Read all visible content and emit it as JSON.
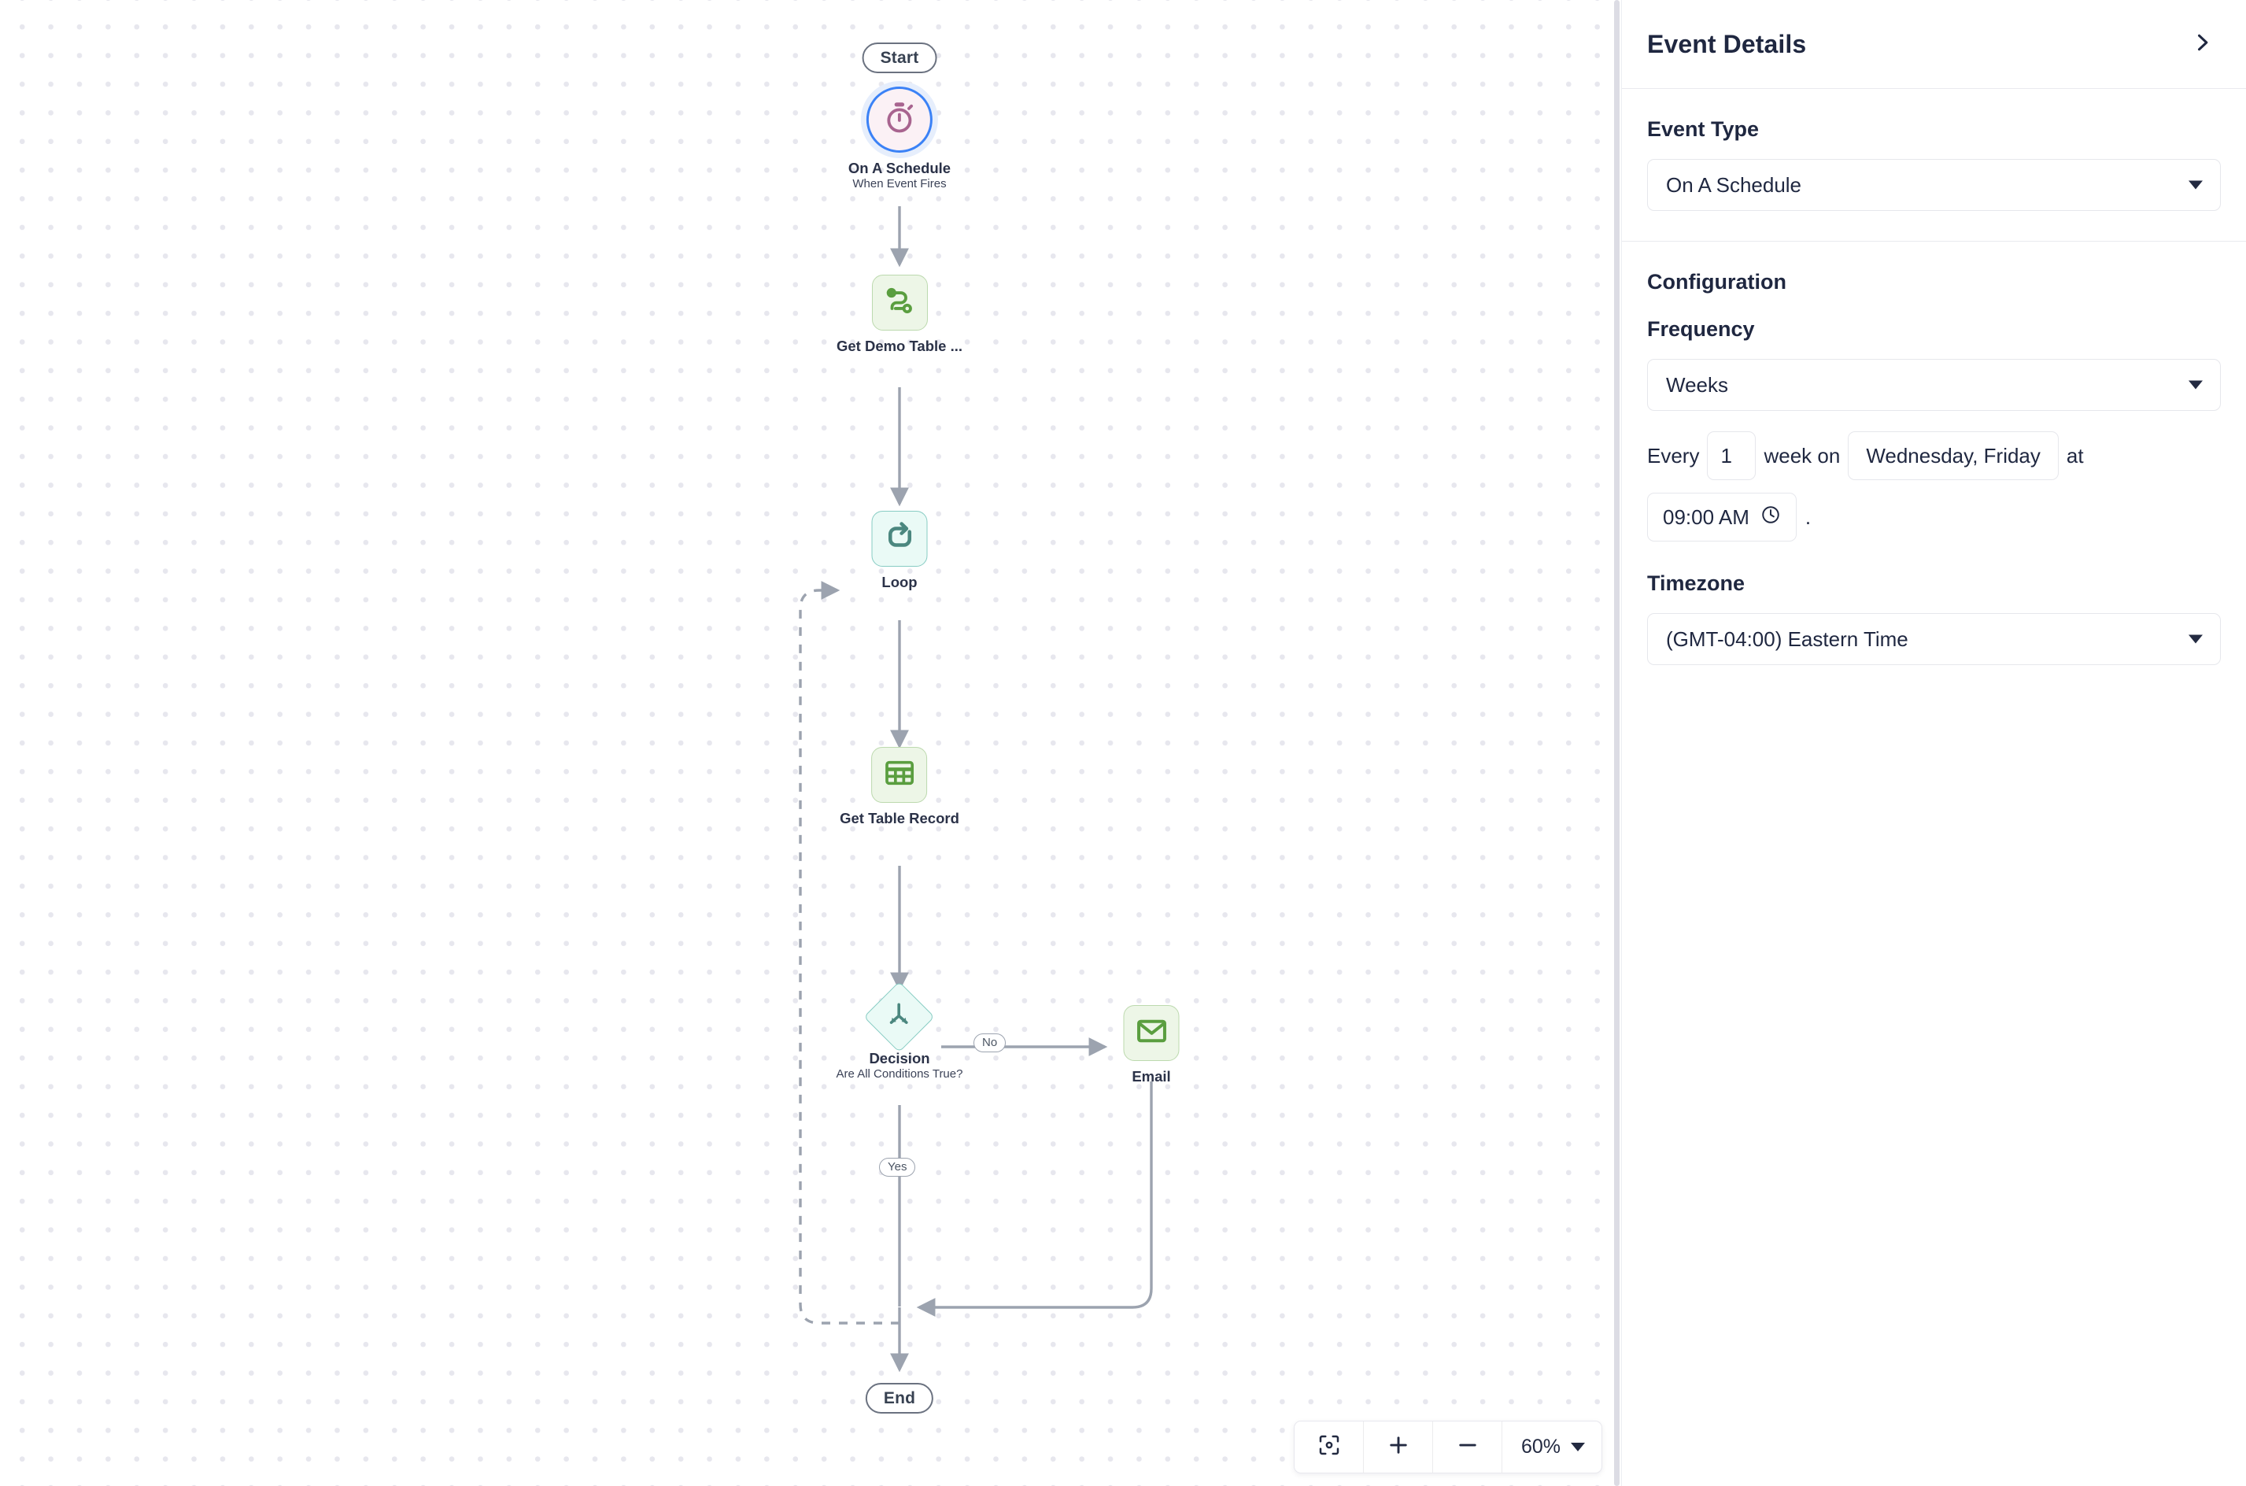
{
  "canvas": {
    "zoom_controls": {
      "fit_icon": "fit-to-screen-icon",
      "zoom_in_label": "+",
      "zoom_out_label": "−",
      "zoom_level": "60%"
    },
    "nodes": [
      {
        "id": "start",
        "type": "pill",
        "label": "Start"
      },
      {
        "id": "trigger",
        "type": "trigger",
        "icon": "timer-icon",
        "title": "On A Schedule",
        "subtitle": "When Event Fires"
      },
      {
        "id": "get-demo",
        "type": "step",
        "icon": "route-icon",
        "title": "Get Demo Table ...",
        "subtitle": ""
      },
      {
        "id": "loop",
        "type": "step",
        "icon": "loop-icon",
        "title": "Loop",
        "subtitle": ""
      },
      {
        "id": "get-record",
        "type": "step",
        "icon": "table-icon",
        "title": "Get Table Record",
        "subtitle": ""
      },
      {
        "id": "decision",
        "type": "diamond",
        "icon": "branch-icon",
        "title": "Decision",
        "subtitle": "Are All Conditions True?"
      },
      {
        "id": "email",
        "type": "step",
        "icon": "envelope-icon",
        "title": "Email",
        "subtitle": ""
      },
      {
        "id": "end",
        "type": "pill",
        "label": "End"
      }
    ],
    "edge_labels": {
      "no": "No",
      "yes": "Yes"
    }
  },
  "panel": {
    "title": "Event Details",
    "collapse_icon": "chevron-right-icon",
    "event_type": {
      "label": "Event Type",
      "value": "On A Schedule"
    },
    "configuration": {
      "title": "Configuration",
      "frequency": {
        "label": "Frequency",
        "value": "Weeks"
      },
      "schedule": {
        "every_text": "Every",
        "interval": "1",
        "unit_text": "week on",
        "days": "Wednesday, Friday",
        "at_text": "at",
        "time": "09:00 AM",
        "clock_icon": "clock-icon",
        "period": "."
      },
      "timezone": {
        "label": "Timezone",
        "value": "(GMT-04:00) Eastern Time"
      }
    }
  },
  "colors": {
    "accent_blue": "#3b82f6",
    "green": "#5a9e3f",
    "teal": "#4b877f",
    "mauve": "#a8648f",
    "edge_gray": "#9ca3af",
    "text_dark": "#1f2740"
  }
}
